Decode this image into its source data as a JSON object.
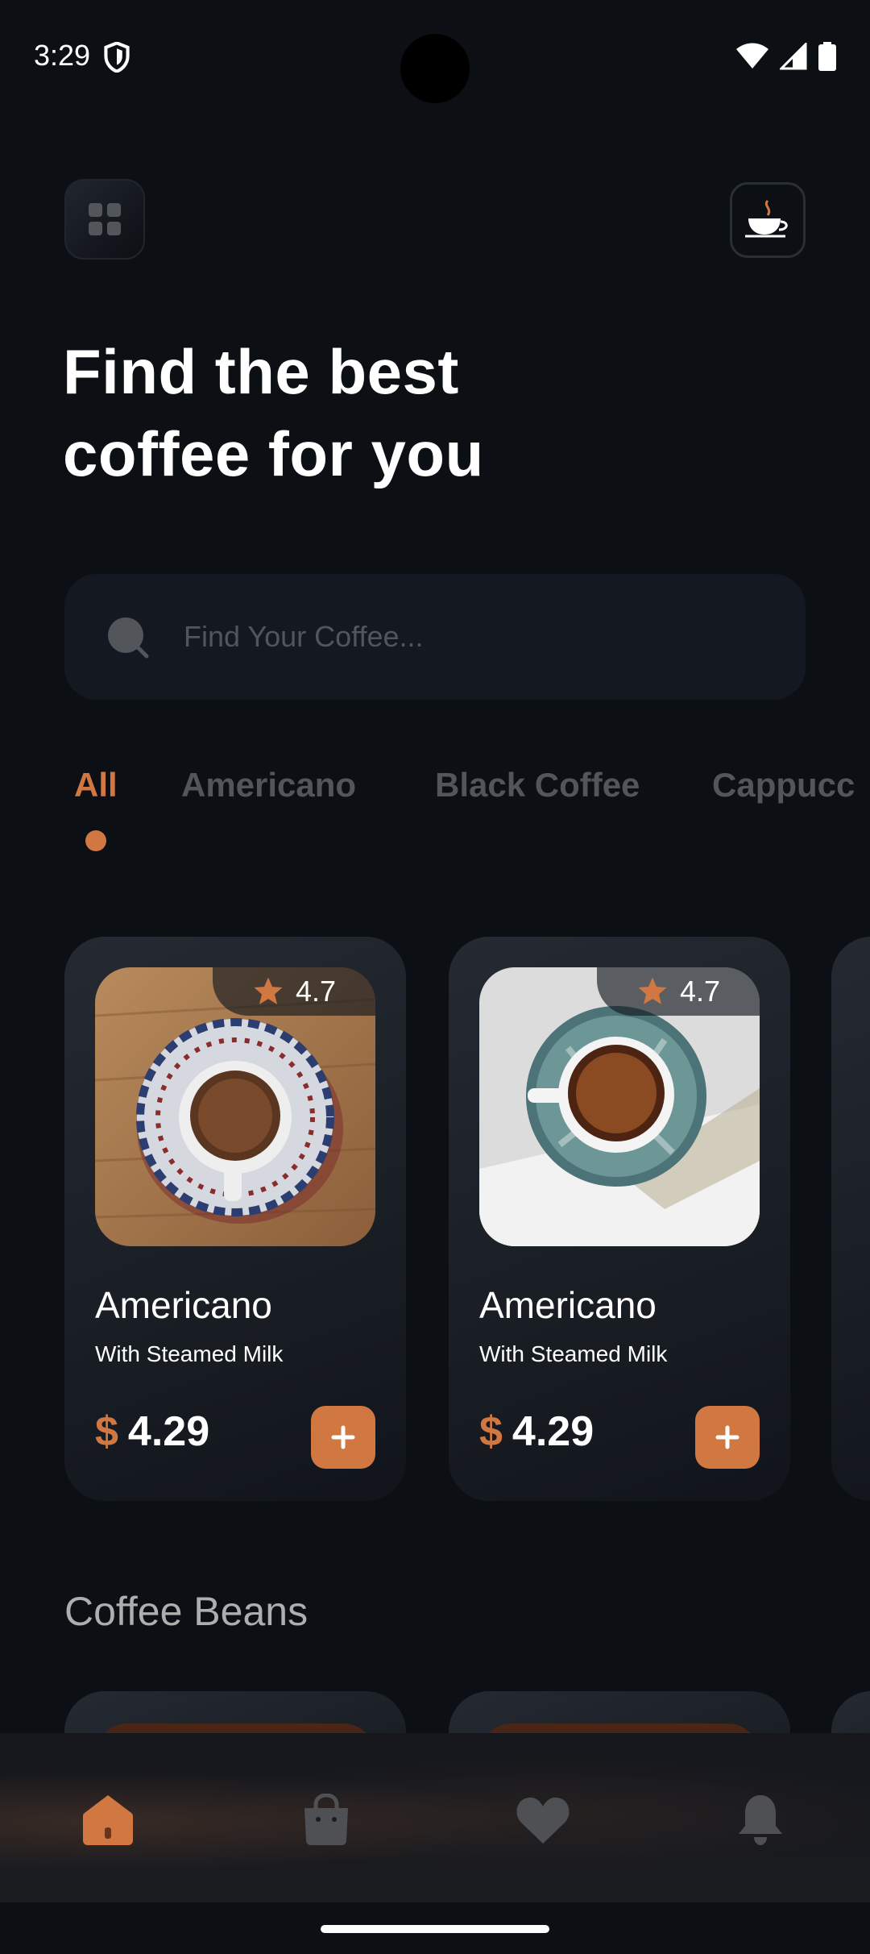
{
  "status": {
    "time": "3:29"
  },
  "header": {
    "title": "Find the best coffee for you"
  },
  "search": {
    "placeholder": "Find Your Coffee..."
  },
  "categories": [
    "All",
    "Americano",
    "Black Coffee",
    "Cappucc"
  ],
  "active_category": "All",
  "products": [
    {
      "name": "Americano",
      "subtitle": "With Steamed Milk",
      "currency": "$",
      "price": "4.29",
      "rating": "4.7"
    },
    {
      "name": "Americano",
      "subtitle": "With Steamed Milk",
      "currency": "$",
      "price": "4.29",
      "rating": "4.7"
    }
  ],
  "section": {
    "title": "Coffee Beans"
  },
  "nav": [
    "home-icon",
    "bag-icon",
    "heart-icon",
    "bell-icon"
  ],
  "colors": {
    "accent": "#D17842",
    "background": "#0C0F14",
    "muted": "#52555A"
  }
}
